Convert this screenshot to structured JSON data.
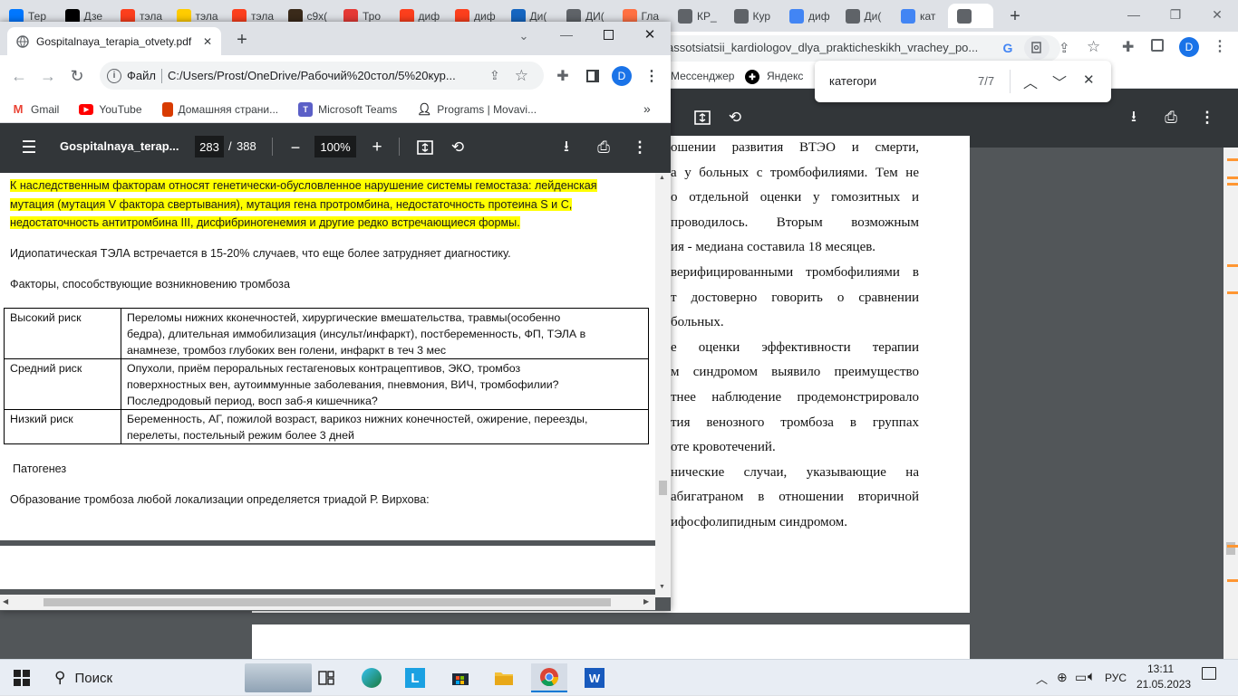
{
  "background_browser": {
    "tabs": [
      {
        "label": "Тер",
        "favicon": "vk-icon",
        "color": "#0077ff"
      },
      {
        "label": "Дзе",
        "favicon": "zen-icon",
        "color": "#000000"
      },
      {
        "label": "тэла",
        "favicon": "yandex-icon",
        "color": "#fc3f1d"
      },
      {
        "label": "тэла",
        "favicon": "yandex-images-icon",
        "color": "#ffcc00"
      },
      {
        "label": "тэла",
        "favicon": "yandex-icon",
        "color": "#fc3f1d"
      },
      {
        "label": "с9х(",
        "favicon": "star-icon",
        "color": "#3a2a1a"
      },
      {
        "label": "Тро",
        "favicon": "pulse-icon",
        "color": "#e53935"
      },
      {
        "label": "диф",
        "favicon": "yandex-icon",
        "color": "#fc3f1d"
      },
      {
        "label": "диф",
        "favicon": "yandex-icon",
        "color": "#fc3f1d"
      },
      {
        "label": "Ди(",
        "favicon": "s-icon",
        "color": "#1565c0"
      },
      {
        "label": "ДИ(",
        "favicon": "globe-icon",
        "color": "#5f6368"
      },
      {
        "label": "Гла",
        "favicon": "plus-icon",
        "color": "#ff7043"
      },
      {
        "label": "КР_",
        "favicon": "globe-icon",
        "color": "#5f6368"
      },
      {
        "label": "Кур",
        "favicon": "doc-icon",
        "color": "#5f6368"
      },
      {
        "label": "диф",
        "favicon": "google-icon",
        "color": "#4285f4"
      },
      {
        "label": "Ди(",
        "favicon": "globe-icon",
        "color": "#5f6368"
      },
      {
        "label": "кат",
        "favicon": "google-icon",
        "color": "#4285f4"
      },
      {
        "label": "",
        "favicon": "globe-icon",
        "color": "#5f6368"
      }
    ],
    "url_fragment": "assotsiatsii_kardiologov_dlya_prakticheskikh_vrachey_po...",
    "bookmarks": [
      {
        "label": "Мессенджер"
      },
      {
        "label": "Яндекс"
      }
    ],
    "page_lines": [
      "ошении развития ВТЭО и смерти,",
      "а у больных с тромбофилиями. Тем не",
      "о отдельной оценки у гомозитных и",
      "проводилось. Вторым возможным",
      "ия - медиана составила 18 месяцев.",
      "верифицированными тромбофилиями в",
      "т достоверно говорить о сравнении",
      "больных.",
      "е оценки эффективности терапии",
      "м синдромом выявило преимущество",
      "тнее наблюдение продемонстрировало",
      "тия венозного тромбоза в группах",
      "оте кровотечений.",
      "нические случаи, указывающие на",
      "абигатраном в отношении вторичной",
      "ифосфолипидным синдромом."
    ],
    "avatar_letter": "D"
  },
  "findbar": {
    "query": "категори",
    "count": "7/7"
  },
  "front_window": {
    "tab_title": "Gospitalnaya_terapia_otvety.pdf",
    "omnibox_label": "Файл",
    "url": "C:/Users/Prost/OneDrive/Рабочий%20стол/5%20кур...",
    "avatar_letter": "D",
    "bookmarks": [
      {
        "label": "Gmail",
        "icon": "gmail-icon"
      },
      {
        "label": "YouTube",
        "icon": "youtube-icon"
      },
      {
        "label": "Домашняя страни...",
        "icon": "office-icon"
      },
      {
        "label": "Microsoft Teams",
        "icon": "teams-icon"
      },
      {
        "label": "Programs | Movavi...",
        "icon": "person-icon"
      }
    ],
    "pdf": {
      "title": "Gospitalnaya_terap...",
      "page_current": "283",
      "page_sep": "/",
      "page_total": "388",
      "zoom": "100%"
    },
    "content": {
      "highlight_lines": [
        "К наследственным факторам относят генетически-обусловленное нарушение системы гемостаза: лейденская",
        "мутация (мутация V фактора свертывания), мутация гена протромбина, недостаточность протеина S и C,",
        "недостаточность антитромбина III, дисфибриногенемия и другие редко встречающиеся формы."
      ],
      "idiopathic": "Идиопатическая ТЭЛА встречается в 15-20% случаев, что еще более затрудняет диагностику.",
      "factors_heading": "Факторы, способствующие возникновению тромбоза",
      "risk_table": [
        {
          "level": "Высокий риск",
          "lines": [
            "Переломы нижних кконечностей, хирургические вмешательства, травмы(особенно",
            "бедра), длительная иммобилизация (инсульт/инфаркт), постбеременность, ФП, ТЭЛА в",
            "анамнезе, тромбоз глубоких вен голени, инфаркт в теч 3 мес"
          ]
        },
        {
          "level": "Средний риск",
          "lines": [
            "Опухоли, приём пероральных гестагеновых контрацептивов, ЭКО, тромбоз",
            "поверхностных вен, аутоиммунные заболевания, пневмония, ВИЧ, тромбофилии?",
            "Последродовый период, восп заб-я кишечника?"
          ]
        },
        {
          "level": "Низкий риск",
          "lines": [
            "Беременность, АГ, пожилой возраст, варикоз нижних конечностей, ожирение, переезды,",
            "перелеты, постельный режим более 3 дней"
          ]
        }
      ],
      "pathogenesis": "Патогенез",
      "virchow": "Образование тромбоза любой локализации определяется триадой Р. Вирхова:"
    }
  },
  "taskbar": {
    "search_label": "Поиск",
    "language": "РУС",
    "time": "13:11",
    "date": "21.05.2023"
  }
}
